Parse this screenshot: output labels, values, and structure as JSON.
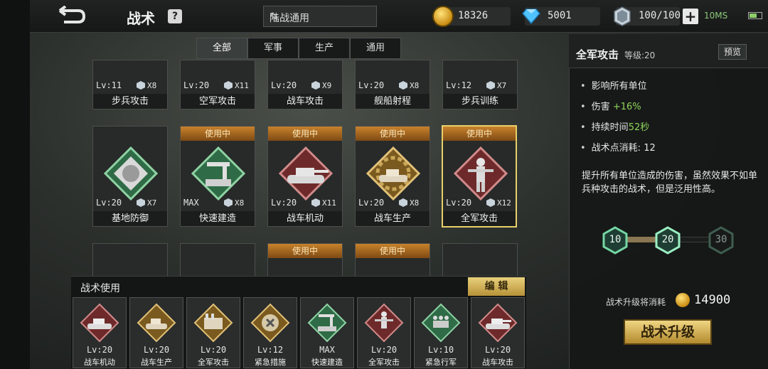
{
  "header": {
    "title": "战术",
    "help": "?",
    "preset_name": "陆战通用"
  },
  "resources": {
    "gold": "18326",
    "diamonds": "5001",
    "crystals": "100/100",
    "plus": "+",
    "ping": "10MS"
  },
  "tabs": [
    {
      "label": "全部",
      "active": true
    },
    {
      "label": "军事",
      "active": false
    },
    {
      "label": "生产",
      "active": false
    },
    {
      "label": "通用",
      "active": false
    }
  ],
  "tactics_row1": [
    {
      "level": "Lv:11",
      "count": "X8",
      "name": "步兵攻击",
      "in_use": false
    },
    {
      "level": "Lv:20",
      "count": "X11",
      "name": "空军攻击",
      "in_use": false
    },
    {
      "level": "Lv:20",
      "count": "X9",
      "name": "战车攻击",
      "in_use": false
    },
    {
      "level": "Lv:20",
      "count": "X8",
      "name": "舰船射程",
      "in_use": false
    },
    {
      "level": "Lv:12",
      "count": "X7",
      "name": "步兵训练",
      "in_use": false
    }
  ],
  "tactics_row2": [
    {
      "level": "Lv:20",
      "count": "X7",
      "name": "基地防御",
      "in_use": false
    },
    {
      "level": "MAX",
      "count": "X8",
      "name": "快速建造",
      "in_use": true
    },
    {
      "level": "Lv:20",
      "count": "X11",
      "name": "战车机动",
      "in_use": true
    },
    {
      "level": "Lv:20",
      "count": "X8",
      "name": "战车生产",
      "in_use": true
    },
    {
      "level": "Lv:20",
      "count": "X12",
      "name": "全军攻击",
      "in_use": true,
      "selected": true
    }
  ],
  "tactics_row3": [
    {
      "in_use": false
    },
    {
      "in_use": false
    },
    {
      "in_use": true
    },
    {
      "in_use": true
    },
    {
      "in_use": false
    }
  ],
  "in_use_label": "使用中",
  "usage": {
    "title": "战术使用",
    "edit_label": "编 辑",
    "items": [
      {
        "level": "Lv:20",
        "name": "战车机动"
      },
      {
        "level": "Lv:20",
        "name": "战车生产"
      },
      {
        "level": "Lv:20",
        "name": "全军攻击"
      },
      {
        "level": "Lv:12",
        "name": "紧急措施"
      },
      {
        "level": "MAX",
        "name": "快速建造"
      },
      {
        "level": "Lv:20",
        "name": "全军攻击"
      },
      {
        "level": "Lv:10",
        "name": "紧急行军"
      },
      {
        "level": "Lv:20",
        "name": "战车攻击"
      }
    ]
  },
  "detail": {
    "name": "全军攻击",
    "level": "等级:20",
    "preview_label": "预览",
    "stats": [
      {
        "label": "影响所有单位",
        "value": ""
      },
      {
        "label": "伤害",
        "value": "+16%"
      },
      {
        "label": "持续时间",
        "value": "52秒"
      },
      {
        "label": "战术点消耗:",
        "value": "12"
      }
    ],
    "description": "提升所有单位造成的伤害，虽然效果不如单兵种攻击的战术，但是泛用性高。",
    "levels": [
      "10",
      "20",
      "30"
    ],
    "cost_label": "战术升级将消耗",
    "cost_value": "14900",
    "upgrade_label": "战术升级"
  },
  "colors": {
    "accent_gold": "#e9cf6a",
    "in_use_orange": "#c8822c",
    "positive_green": "#8ed45a"
  }
}
